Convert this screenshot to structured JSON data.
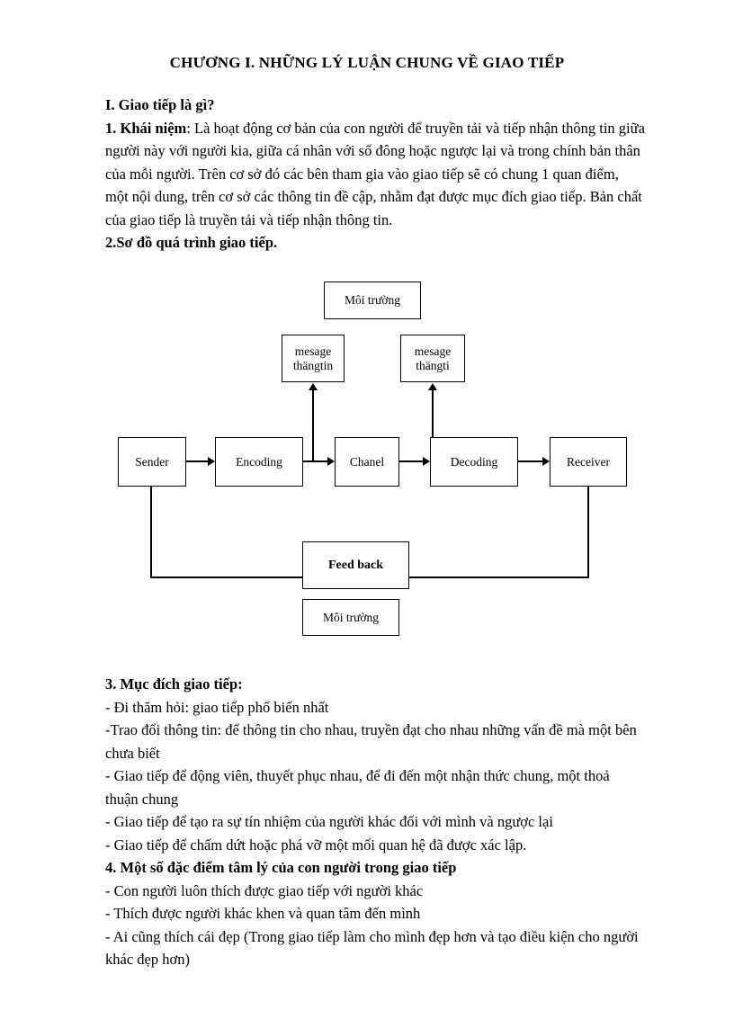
{
  "document": {
    "title": "CHƯƠNG I. NHỮNG LÝ LUẬN CHUNG VỀ GIAO TIẾP"
  },
  "section_one": {
    "heading": "I. Giao tiếp là gì?",
    "item1_label": "1. Khái niệm",
    "item1_text": ": Là hoạt động cơ bản của con người để truyền tải và tiếp nhận thông tin giữa người này với người kia, giữa cá nhân với số đông hoặc ngược lại và trong chính bản thân của mỗi người. Trên cơ sở đó các bên tham gia vào giao tiếp sẽ có chung 1 quan điểm, một nội dung, trên cơ sở các thông tin đề cập, nhằm đạt được mục đích giao tiếp. Bản chất của giao tiếp là truyền tải và tiếp nhận thông tin.",
    "item2_label": "2.Sơ đồ quá trình giao tiếp."
  },
  "section_three": {
    "heading": "3. Mục đích giao tiếp:",
    "bullets": [
      "- Đi thăm hỏi: giao tiếp phổ biến nhất",
      "-Trao đổi thông tin: để thông tin cho nhau, truyền đạt cho nhau những vấn đề mà một bên chưa biết",
      "- Giao tiếp để động viên, thuyết phục nhau, để đi đến một nhận thức chung, một thoả thuận chung",
      "- Giao tiếp để tạo ra sự tín nhiệm của người khác đối với mình và ngược lại",
      "- Giao tiếp để chấm dứt hoặc phá vỡ một mối quan hệ đã được xác lập."
    ]
  },
  "section_four": {
    "heading": "4. Một số đặc điểm tâm lý của con người trong giao tiếp",
    "bullets": [
      "- Con người luôn thích được giao tiếp với người khác",
      "- Thích được người khác khen và quan tâm đến mình",
      "- Ai cũng thích cái đẹp (Trong giao tiếp làm cho mình đẹp hơn và tạo điều kiện cho người khác đẹp hơn)"
    ]
  },
  "diagram": {
    "type": "flowchart",
    "nodes": [
      {
        "id": "moi-truong-top",
        "label": "Môi trường"
      },
      {
        "id": "mesage-thangtin",
        "label_line1": "mesage",
        "label_line2": "thängtin"
      },
      {
        "id": "mesage-thangti",
        "label_line1": "mesage",
        "label_line2": "thängti"
      },
      {
        "id": "sender",
        "label": "Sender"
      },
      {
        "id": "encoding",
        "label": "Encoding"
      },
      {
        "id": "chanel",
        "label": "Chanel"
      },
      {
        "id": "decoding",
        "label": "Decoding"
      },
      {
        "id": "receiver",
        "label": "Receiver"
      },
      {
        "id": "feed-back",
        "label": "Feed back"
      },
      {
        "id": "moi-truong-bottom",
        "label": "Môi trường"
      }
    ],
    "edges": [
      {
        "from": "sender",
        "to": "encoding",
        "kind": "arrow-right"
      },
      {
        "from": "encoding",
        "to": "chanel",
        "kind": "arrow-right"
      },
      {
        "from": "chanel",
        "to": "decoding",
        "kind": "arrow-right"
      },
      {
        "from": "decoding",
        "to": "receiver",
        "kind": "arrow-right"
      },
      {
        "from": "encoding-chanel-link",
        "to": "mesage-thangtin",
        "kind": "arrow-up"
      },
      {
        "from": "chanel-decoding-link",
        "to": "mesage-thangti",
        "kind": "arrow-up"
      },
      {
        "from": "receiver",
        "to": "feed-back",
        "kind": "line"
      },
      {
        "from": "feed-back",
        "to": "sender",
        "kind": "line"
      }
    ],
    "colors": {
      "stroke": "#000000",
      "fill": "#ffffff"
    }
  }
}
